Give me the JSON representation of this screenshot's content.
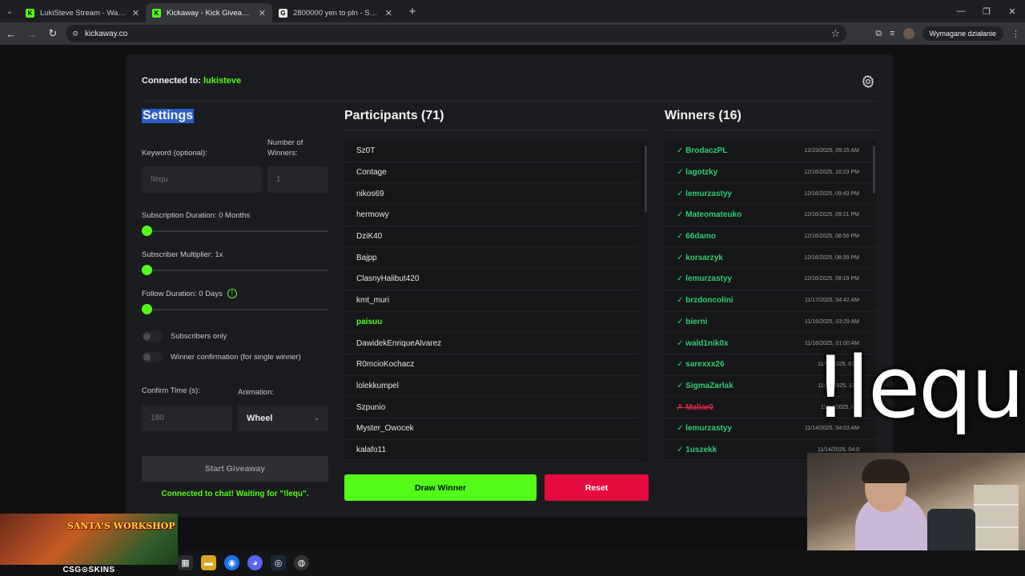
{
  "browser": {
    "tabs": [
      {
        "label": "LukiSteve Stream - Watch Live o",
        "favicon": "K",
        "active": false,
        "color": "#53fc18"
      },
      {
        "label": "Kickaway - Kick Giveaway Tool",
        "favicon": "K",
        "active": true,
        "color": "#53fc18"
      },
      {
        "label": "2800000 yen to pln - Szukaj w G",
        "favicon": "G",
        "active": false,
        "color": "#e8e8e8"
      }
    ],
    "url": "kickaway.co",
    "action_label": "Wymagane działanie"
  },
  "header": {
    "connected_prefix": "Connected to: ",
    "connected_user": "lukisteve"
  },
  "settings": {
    "title": "Settings",
    "keyword_label": "Keyword (optional):",
    "keyword_placeholder": "!lequ",
    "winners_label": "Number of Winners:",
    "winners_placeholder": "1",
    "sub_duration_label": "Subscription Duration: 0 Months",
    "sub_multiplier_label": "Subscriber Multiplier: 1x",
    "follow_duration_label": "Follow Duration: 0 Days",
    "subscribers_only_label": "Subscribers only",
    "winner_confirm_label": "Winner confirmation (for single winner)",
    "confirm_time_label": "Confirm Time (s):",
    "confirm_time_placeholder": "180",
    "animation_label": "Animation:",
    "animation_value": "Wheel",
    "start_button": "Start Giveaway",
    "status_text": "Connected to chat! Waiting for \"!lequ\"."
  },
  "participants": {
    "title": "Participants (71)",
    "highlighted": "paisuu",
    "items": [
      "Sz0T",
      "Contage",
      "nikos69",
      "hermowy",
      "DziK40",
      "Bajpp",
      "ClasnyHalibut420",
      "kmt_muri",
      "paisuu",
      "DawidekEnriqueAlvarez",
      "R0mcioKochacz",
      "lolekkumpel",
      "Szpunio",
      "Myster_Owocek",
      "kalafo11"
    ],
    "draw_button": "Draw Winner",
    "reset_button": "Reset"
  },
  "winners": {
    "title": "Winners (16)",
    "items": [
      {
        "mark": "✓",
        "name": "BrodaczPL",
        "date": "12/23/2025, 05:15 AM",
        "rejected": false
      },
      {
        "mark": "✓",
        "name": "lagotzky",
        "date": "12/16/2025, 10:23 PM",
        "rejected": false
      },
      {
        "mark": "✓",
        "name": "lemurzastyy",
        "date": "12/16/2025, 09:43 PM",
        "rejected": false
      },
      {
        "mark": "✓",
        "name": "Mateomateuko",
        "date": "12/16/2025, 09:21 PM",
        "rejected": false
      },
      {
        "mark": "✓",
        "name": "66damo",
        "date": "12/16/2025, 08:56 PM",
        "rejected": false
      },
      {
        "mark": "✓",
        "name": "korsarzyk",
        "date": "12/16/2025, 08:39 PM",
        "rejected": false
      },
      {
        "mark": "✓",
        "name": "lemurzastyy",
        "date": "12/16/2025, 08:19 PM",
        "rejected": false
      },
      {
        "mark": "✓",
        "name": "brzdoncolini",
        "date": "11/17/2025, 04:42 AM",
        "rejected": false
      },
      {
        "mark": "✓",
        "name": "bierni",
        "date": "11/16/2025, 03:29 AM",
        "rejected": false
      },
      {
        "mark": "✓",
        "name": "wald1nik0x",
        "date": "11/16/2025, 01:00 AM",
        "rejected": false
      },
      {
        "mark": "✓",
        "name": "sarexxx26",
        "date": "11/16/2025, 01:1",
        "rejected": false
      },
      {
        "mark": "✓",
        "name": "SigmaZarlak",
        "date": "11/14/2025, 11:1",
        "rejected": false
      },
      {
        "mark": "✗",
        "name": "Maliar0",
        "date": "11/14/2025, 09:",
        "rejected": true
      },
      {
        "mark": "✓",
        "name": "lemurzastyy",
        "date": "11/14/2025, 04:03 AM",
        "rejected": false
      },
      {
        "mark": "✓",
        "name": "1uszekk",
        "date": "11/14/2025, 04:0",
        "rejected": false
      }
    ]
  },
  "overlay": {
    "big_text": "!lequ",
    "promo_title": "SANTA'S WORKSHOP",
    "promo_brand": "CSG⊙SKINS"
  },
  "colors": {
    "accent": "#53fc18",
    "danger": "#e50b3c",
    "winner": "#2ecc71"
  }
}
